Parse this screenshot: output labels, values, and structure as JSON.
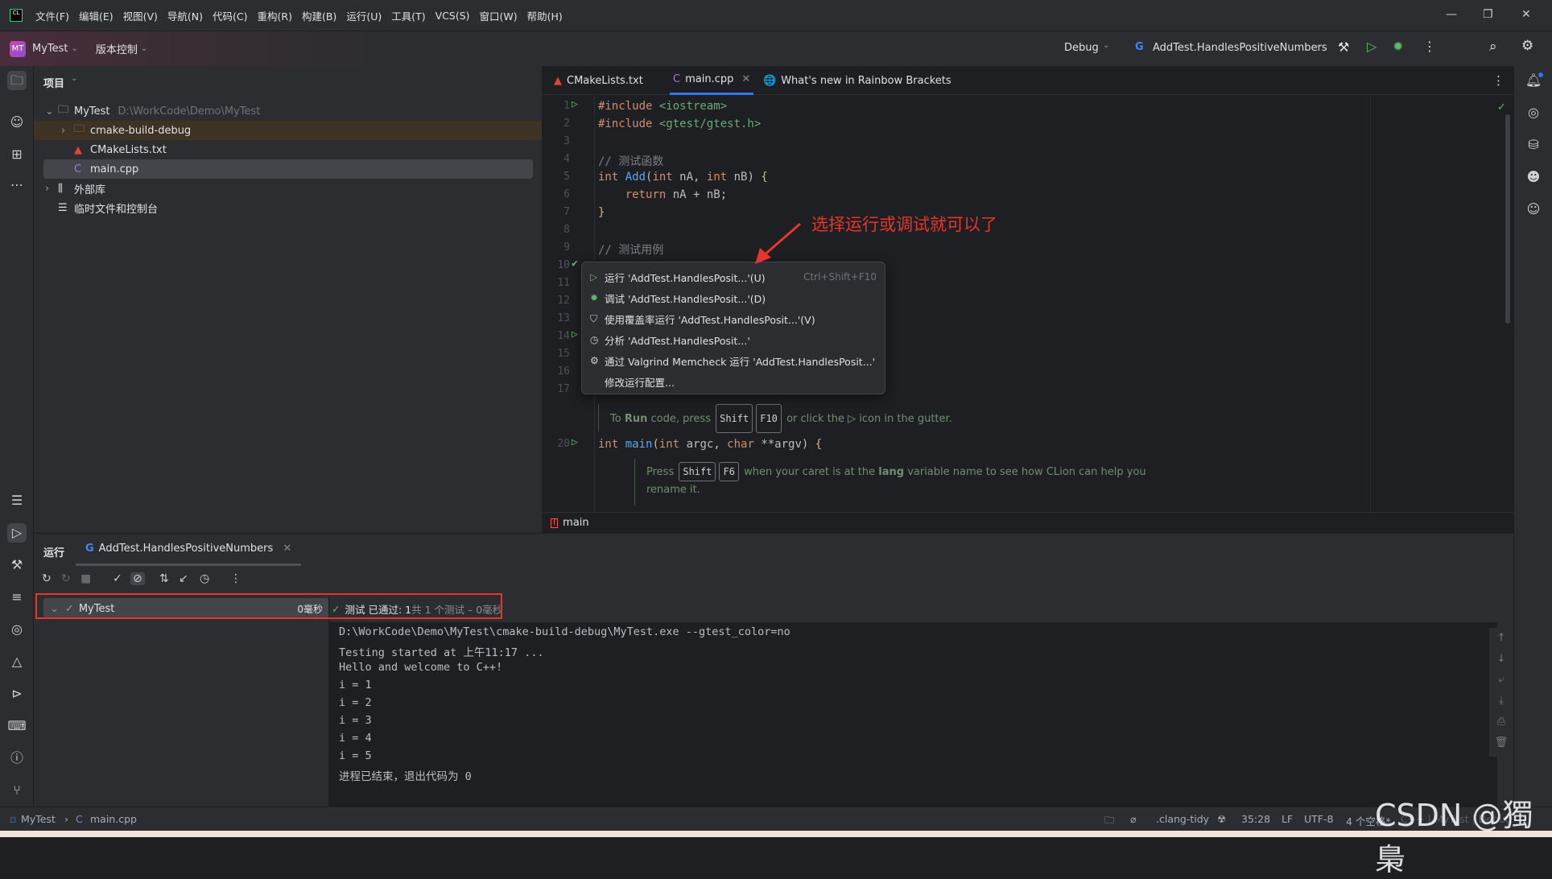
{
  "menubar": {
    "items": [
      "文件(F)",
      "编辑(E)",
      "视图(V)",
      "导航(N)",
      "代码(C)",
      "重构(R)",
      "构建(B)",
      "运行(U)",
      "工具(T)",
      "VCS(S)",
      "窗口(W)",
      "帮助(H)"
    ],
    "logo": "CL"
  },
  "toolbar": {
    "project_badge": "MT",
    "project": "MyTest",
    "vcs": "版本控制",
    "config": "Debug",
    "run_target": "AddTest.HandlesPositiveNumbers"
  },
  "project_panel": {
    "title": "项目",
    "root": "MyTest",
    "root_path": "D:\\WorkCode\\Demo\\MyTest",
    "items": [
      "cmake-build-debug",
      "CMakeLists.txt",
      "main.cpp"
    ],
    "external": "外部库",
    "scratches": "临时文件和控制台"
  },
  "editor": {
    "tabs": [
      "CMakeLists.txt",
      "main.cpp",
      "What's new in Rainbow Brackets"
    ],
    "lines": {
      "l1a": "#include ",
      "l1b": "<iostream>",
      "l2a": "#include ",
      "l2b": "<gtest/gtest.h>",
      "l4": "// 测试函数",
      "l5a": "int ",
      "l5b": "Add",
      "l5c": "(",
      "l5d": "int ",
      "l5e": "nA, ",
      "l5f": "int ",
      "l5g": "nB) ",
      "l5h": "{",
      "l6a": "    return ",
      "l6b": "nA + nB;",
      "l7": "}",
      "l9": "// 测试用例",
      "l20a": "int ",
      "l20b": "main",
      "l20c": "(",
      "l20d": "int ",
      "l20e": "argc, ",
      "l20f": "char ",
      "l20g": "**argv) ",
      "l20h": "{"
    },
    "line_numbers": [
      "1",
      "2",
      "3",
      "4",
      "5",
      "6",
      "7",
      "8",
      "9",
      "10",
      "11",
      "12",
      "13",
      "14",
      "15",
      "16",
      "17",
      "20"
    ],
    "hint1": {
      "a": "To ",
      "b": "Run",
      "c": " code, press",
      "k1": "Shift",
      "k2": "F10",
      "d": "or click the",
      "e": "icon in the gutter."
    },
    "hint2": {
      "a": "Press",
      "k1": "Shift",
      "k2": "F6",
      "b": "when your caret is at the ",
      "c": "lang",
      "d": " variable name to see how CLion can help you",
      "e": "rename it."
    },
    "breadcrumb": "main"
  },
  "context_menu": {
    "items": [
      {
        "label": "运行 'AddTest.HandlesPosit...'(U)",
        "shortcut": "Ctrl+Shift+F10",
        "icon": "play-icon"
      },
      {
        "label": "调试 'AddTest.HandlesPosit...'(D)",
        "icon": "bug-icon"
      },
      {
        "label": "使用覆盖率运行 'AddTest.HandlesPosit...'(V)",
        "icon": "coverage-icon"
      },
      {
        "label": "分析 'AddTest.HandlesPosit...'",
        "icon": "profiler-icon"
      },
      {
        "label": "通过 Valgrind Memcheck 运行 'AddTest.HandlesPosit...'",
        "icon": "valgrind-icon"
      },
      {
        "label": "修改运行配置..."
      }
    ]
  },
  "annotation": "选择运行或调试就可以了",
  "run_panel": {
    "title": "运行",
    "tab": "AddTest.HandlesPositiveNumbers",
    "tree_root": "MyTest",
    "tree_time": "0毫秒",
    "status_a": "测试 已通过: 1",
    "status_b": "共 1 个测试 – 0毫秒"
  },
  "console": [
    "D:\\WorkCode\\Demo\\MyTest\\cmake-build-debug\\MyTest.exe --gtest_color=no",
    "Testing started at 上午11:17 ...",
    "Hello and welcome to C++!",
    "i = 1",
    "i = 2",
    "i = 3",
    "i = 4",
    "i = 5",
    "进程已结束，退出代码为 0"
  ],
  "statusbar": {
    "project": "MyTest",
    "file": "main.cpp",
    "clang_tidy": ".clang-tidy",
    "position": "35:28",
    "line_sep": "LF",
    "encoding": "UTF-8",
    "indent": "4 个空格*",
    "context": "C++ | MyTest | Debug"
  },
  "watermark": "CSDN @獨梟",
  "colors": {
    "accent": "#3574f0",
    "run_green": "#5fb865",
    "annotation_red": "#e8352b",
    "highlight_box": "#e8352b"
  }
}
